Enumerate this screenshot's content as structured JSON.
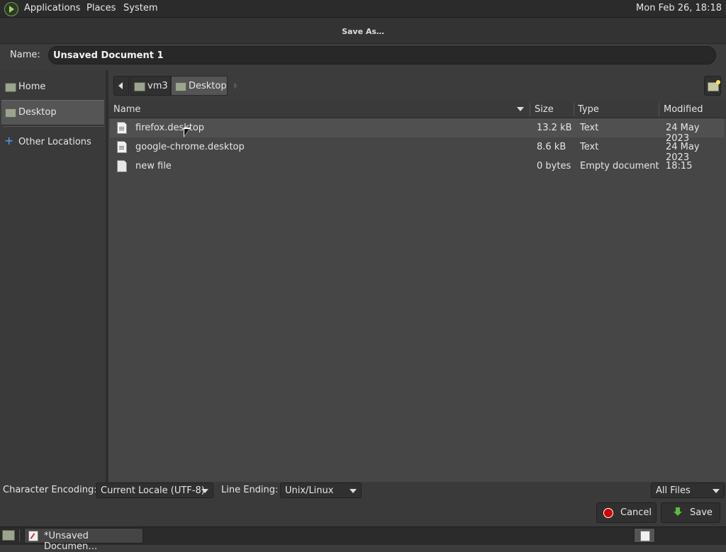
{
  "top_panel": {
    "menus": [
      "Applications",
      "Places",
      "System"
    ],
    "clock": "Mon Feb 26, 18:18"
  },
  "dialog": {
    "title": "Save As…",
    "name_label": "Name:",
    "name_value": "Unsaved Document 1"
  },
  "sidebar": {
    "items": [
      {
        "label": "Home",
        "icon": "home-folder-icon"
      },
      {
        "label": "Desktop",
        "icon": "desktop-folder-icon",
        "selected": true
      },
      {
        "label": "Other Locations",
        "icon": "plus-icon"
      }
    ]
  },
  "pathbar": {
    "crumbs": [
      "vm3",
      "Desktop"
    ]
  },
  "file_list": {
    "columns": [
      "Name",
      "Size",
      "Type",
      "Modified"
    ],
    "rows": [
      {
        "name": "firefox.desktop",
        "size": "13.2 kB",
        "type": "Text",
        "modified": "24 May 2023",
        "icon": "text-file-icon"
      },
      {
        "name": "google-chrome.desktop",
        "size": "8.6 kB",
        "type": "Text",
        "modified": "24 May 2023",
        "icon": "text-file-icon"
      },
      {
        "name": "new file",
        "size": "0 bytes",
        "type": "Empty document",
        "modified": "18:15",
        "icon": "empty-file-icon"
      }
    ]
  },
  "options": {
    "encoding_label": "Character Encoding:",
    "encoding_value": "Current Locale (UTF-8)",
    "line_ending_label": "Line Ending:",
    "line_ending_value": "Unix/Linux",
    "filter_value": "All Files"
  },
  "buttons": {
    "cancel": "Cancel",
    "save": "Save"
  },
  "taskbar": {
    "window_title": "*Unsaved Documen…"
  },
  "colors": {
    "background": "#3c3c3c",
    "list_background": "#464646",
    "selected": "#555555",
    "cancel_icon": "#d40000",
    "save_icon": "#5bbd3a",
    "other_locations_icon": "#4aa3ff"
  }
}
